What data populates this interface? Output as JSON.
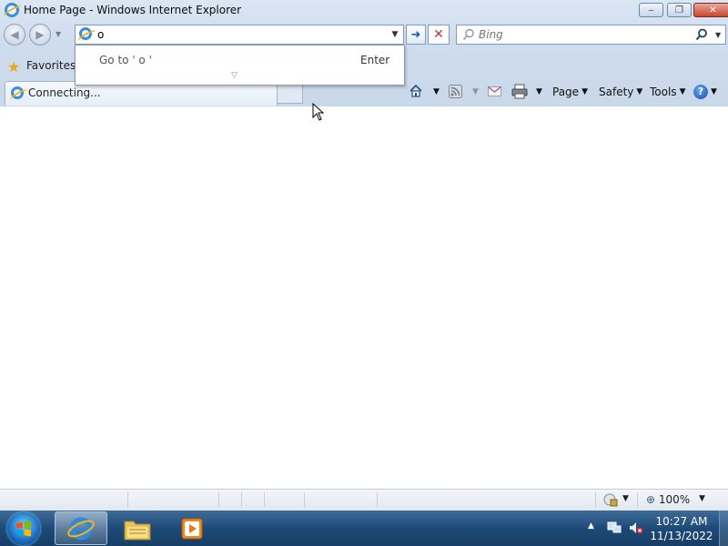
{
  "window": {
    "title": "Home Page - Windows Internet Explorer",
    "minimize_glyph": "‒",
    "restore_glyph": "❐",
    "close_glyph": "✕"
  },
  "address_bar": {
    "value": "o",
    "dropdown_glyph": "▼",
    "go_glyph": "➜",
    "stop_glyph": "✕"
  },
  "search": {
    "placeholder": "Bing",
    "icon": "magnifier-icon"
  },
  "autocomplete": {
    "text": "Go to ' o '",
    "shortcut": "Enter"
  },
  "favorites": {
    "label": "Favorites"
  },
  "tab": {
    "label": "Connecting..."
  },
  "command_bar": {
    "page": "Page",
    "safety": "Safety",
    "tools": "Tools"
  },
  "status_bar": {
    "zoom": "100%"
  },
  "taskbar": {
    "time": "10:27 AM",
    "date": "11/13/2022"
  },
  "colors": {
    "chrome_bg": "#cfdcec",
    "close_button": "#c8452e",
    "taskbar": "#1e4a78"
  }
}
